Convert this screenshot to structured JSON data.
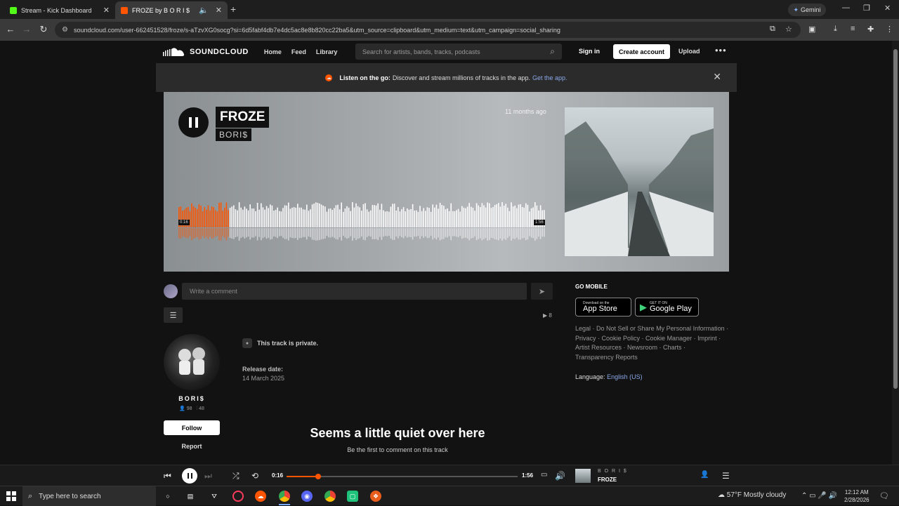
{
  "browser": {
    "tabs": [
      {
        "title": "Stream - Kick Dashboard",
        "favicon_color": "#53fc18"
      },
      {
        "title": "FROZE by B O R I $",
        "favicon_color": "#ff5500"
      }
    ],
    "gemini_label": "Gemini",
    "url": "soundcloud.com/user-662451528/froze/s-aTzvXG0socg?si=6d5fabf4db7e4dc5ac8e8b820cc22ba5&utm_source=clipboard&utm_medium=text&utm_campaign=social_sharing"
  },
  "header": {
    "logo": "SOUNDCLOUD",
    "nav": [
      "Home",
      "Feed",
      "Library"
    ],
    "search_placeholder": "Search for artists, bands, tracks, podcasts",
    "signin": "Sign in",
    "create_account": "Create account",
    "upload": "Upload"
  },
  "banner": {
    "bold": "Listen on the go:",
    "text": "Discover and stream millions of tracks in the app.",
    "link": "Get the app."
  },
  "track": {
    "title": "FROZE",
    "artist": "BORI$",
    "posted": "11 months ago",
    "current_time": "0:16",
    "duration": "1:56",
    "progress": 0.138
  },
  "comment": {
    "placeholder": "Write a comment"
  },
  "plays": "8",
  "artist": {
    "name": "BORI$",
    "followers": "98",
    "tracks": "48",
    "follow": "Follow",
    "report": "Report"
  },
  "info": {
    "private": "This track is private.",
    "release_label": "Release date:",
    "release_value": "14 March 2025"
  },
  "empty": {
    "title": "Seems a little quiet over here",
    "sub": "Be the first to comment on this track"
  },
  "sidebar": {
    "go_mobile": "GO MOBILE",
    "appstore_small": "Download on the",
    "appstore_big": "App Store",
    "gplay_small": "GET IT ON",
    "gplay_big": "Google Play",
    "links": [
      "Legal",
      "Do Not Sell or Share My Personal Information",
      "Privacy",
      "Cookie Policy",
      "Cookie Manager",
      "Imprint",
      "Artist Resources",
      "Newsroom",
      "Charts",
      "Transparency Reports"
    ],
    "language_label": "Language:",
    "language_value": "English (US)"
  },
  "player": {
    "current": "0:16",
    "duration": "1:56",
    "artist": "B O R I $",
    "title": "FROZE",
    "progress": 0.138
  },
  "taskbar": {
    "search_placeholder": "Type here to search",
    "weather": "57°F  Mostly cloudy",
    "time": "12:12 AM",
    "date": "2/28/2026"
  },
  "colors": {
    "accent": "#ff5500",
    "link": "#8aa8e8"
  }
}
